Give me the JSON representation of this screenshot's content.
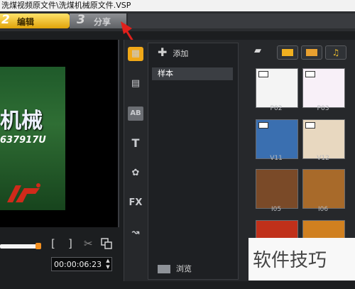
{
  "window": {
    "title": "洗煤视频原文件\\洗煤机械原文件.VSP"
  },
  "steps": [
    {
      "num": "2",
      "label": "编辑"
    },
    {
      "num": "3",
      "label": "分享"
    }
  ],
  "preview": {
    "overlay_title": "机械",
    "overlay_number": "637917U",
    "progress": 0.33,
    "mark_in": "[",
    "mark_out": "]",
    "timecode": "00:00:06:23"
  },
  "library": {
    "add_label": "添加",
    "folder_selected": "样本",
    "browse_label": "浏览",
    "side_icons": [
      "video-icon",
      "transition-ab-icon",
      "title-t-icon",
      "graphic-icon",
      "fx-icon",
      "path-icon"
    ],
    "fx_text": "FX",
    "ab_text": "AB",
    "t_text": "T",
    "thumbs": [
      {
        "label": "P02",
        "bg": "#f4f4f4"
      },
      {
        "label": "P03",
        "bg": "#f8f0f8"
      },
      {
        "label": "V11",
        "bg": "#3a6fb0"
      },
      {
        "label": "V12",
        "bg": "#e8d8c0"
      },
      {
        "label": "I05",
        "bg": "#7a4a28"
      },
      {
        "label": "I06",
        "bg": "#a86a2a"
      }
    ]
  },
  "watermark": "软件技巧"
}
